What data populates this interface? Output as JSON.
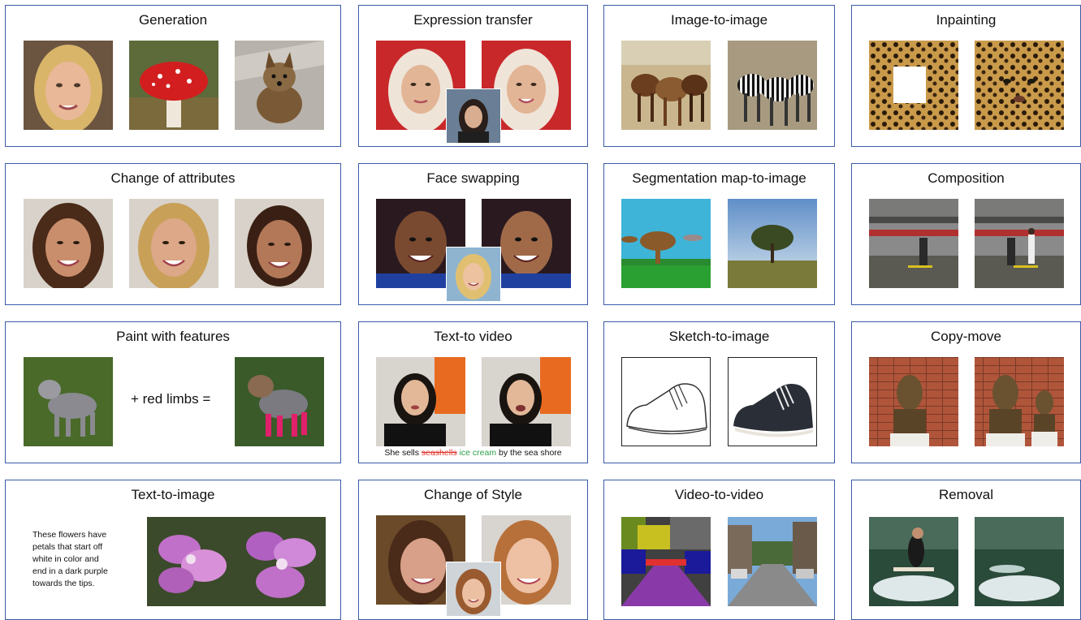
{
  "panels": {
    "generation": {
      "title": "Generation"
    },
    "expression_transfer": {
      "title": "Expression transfer"
    },
    "image_to_image": {
      "title": "Image-to-image"
    },
    "inpainting": {
      "title": "Inpainting"
    },
    "change_of_attributes": {
      "title": "Change of attributes"
    },
    "face_swapping": {
      "title": "Face swapping"
    },
    "segmentation_map_to_image": {
      "title": "Segmentation map-to-image"
    },
    "composition": {
      "title": "Composition"
    },
    "paint_with_features": {
      "title": "Paint with features",
      "operator_text": "+ red limbs ="
    },
    "text_to_video": {
      "title": "Text-to video",
      "caption_prefix": "She sells",
      "caption_struck": "seashells",
      "caption_inserted": "ice cream",
      "caption_suffix": "by the sea shore"
    },
    "sketch_to_image": {
      "title": "Sketch-to-image"
    },
    "copy_move": {
      "title": "Copy-move"
    },
    "text_to_image": {
      "title": "Text-to-image",
      "prompt_lines": [
        "These flowers have",
        "petals that start off",
        "white in color and",
        "end in a dark purple",
        "towards the tips."
      ]
    },
    "change_of_style": {
      "title": "Change of Style"
    },
    "video_to_video": {
      "title": "Video-to-video"
    },
    "removal": {
      "title": "Removal"
    }
  },
  "colors": {
    "panel_border": "#3b5aa8",
    "strike": "#e0342c",
    "inserted": "#2fa04a"
  }
}
